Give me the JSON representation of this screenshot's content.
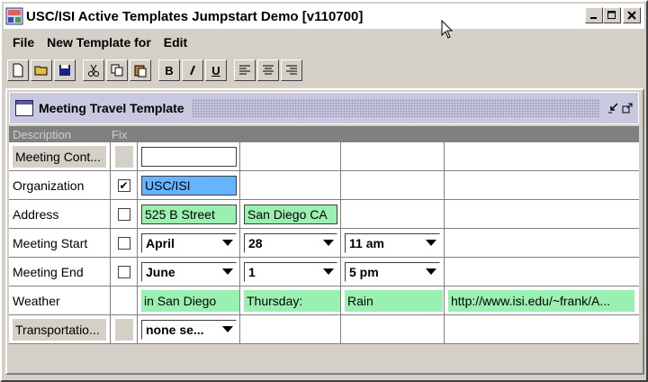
{
  "window": {
    "title": "USC/ISI Active Templates Jumpstart Demo [v110700]"
  },
  "menu": [
    "File",
    "New Template for",
    "Edit"
  ],
  "toolbar": {
    "bold": "B",
    "italic": "I",
    "underline": "U"
  },
  "template": {
    "title": "Meeting Travel Template",
    "headers": {
      "description": "Description",
      "fix": "Fix"
    },
    "rows": {
      "contact": {
        "label": "Meeting Cont...",
        "value": ""
      },
      "organization": {
        "label": "Organization",
        "value": "USC/ISI",
        "fixed": "✔"
      },
      "address": {
        "label": "Address",
        "street": "525 B Street",
        "city": "San Diego CA"
      },
      "start": {
        "label": "Meeting Start",
        "month": "April",
        "day": "28",
        "time": "11 am"
      },
      "end": {
        "label": "Meeting End",
        "month": "June",
        "day": "1",
        "time": "5 pm"
      },
      "weather": {
        "label": "Weather",
        "place": "in San Diego",
        "day": "Thursday:",
        "condition": "Rain",
        "url": "http://www.isi.edu/~frank/A..."
      },
      "transport": {
        "label": "Transportatio...",
        "value": "none se..."
      }
    }
  },
  "colors": {
    "blue_field": "#66b3ff",
    "green_field": "#99f0b0",
    "header_bg": "#808080"
  }
}
